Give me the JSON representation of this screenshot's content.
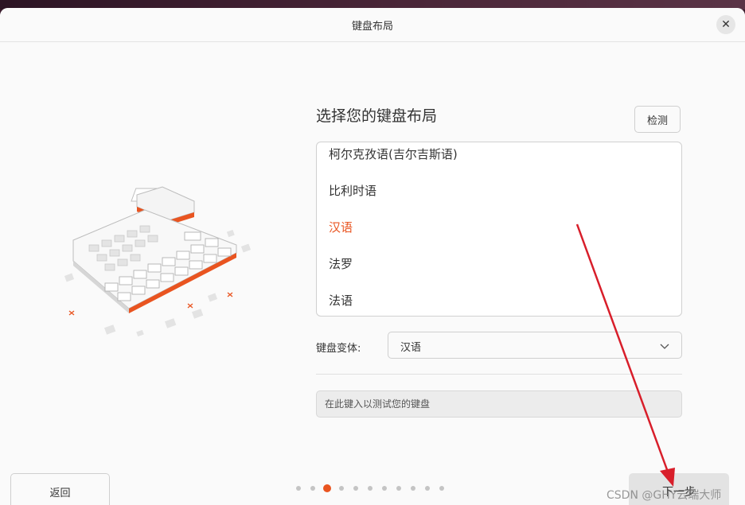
{
  "window": {
    "title": "键盘布局",
    "close_icon": "close-icon"
  },
  "main": {
    "heading": "选择您的键盘布局",
    "detect_label": "检测",
    "layouts": [
      {
        "label": "柯尔克孜语(吉尔吉斯语)",
        "selected": false
      },
      {
        "label": "比利时语",
        "selected": false
      },
      {
        "label": "汉语",
        "selected": true
      },
      {
        "label": "法罗",
        "selected": false
      },
      {
        "label": "法语",
        "selected": false
      }
    ],
    "variant_label": "键盘变体:",
    "variant_value": "汉语",
    "test_placeholder": "在此键入以测试您的键盘"
  },
  "footer": {
    "back_label": "返回",
    "next_label": "下一步",
    "progress": {
      "total": 11,
      "current": 3
    }
  },
  "watermark": "CSDN @GHY云端大师",
  "colors": {
    "accent": "#e95420",
    "annotation_arrow": "#d81e2a"
  }
}
